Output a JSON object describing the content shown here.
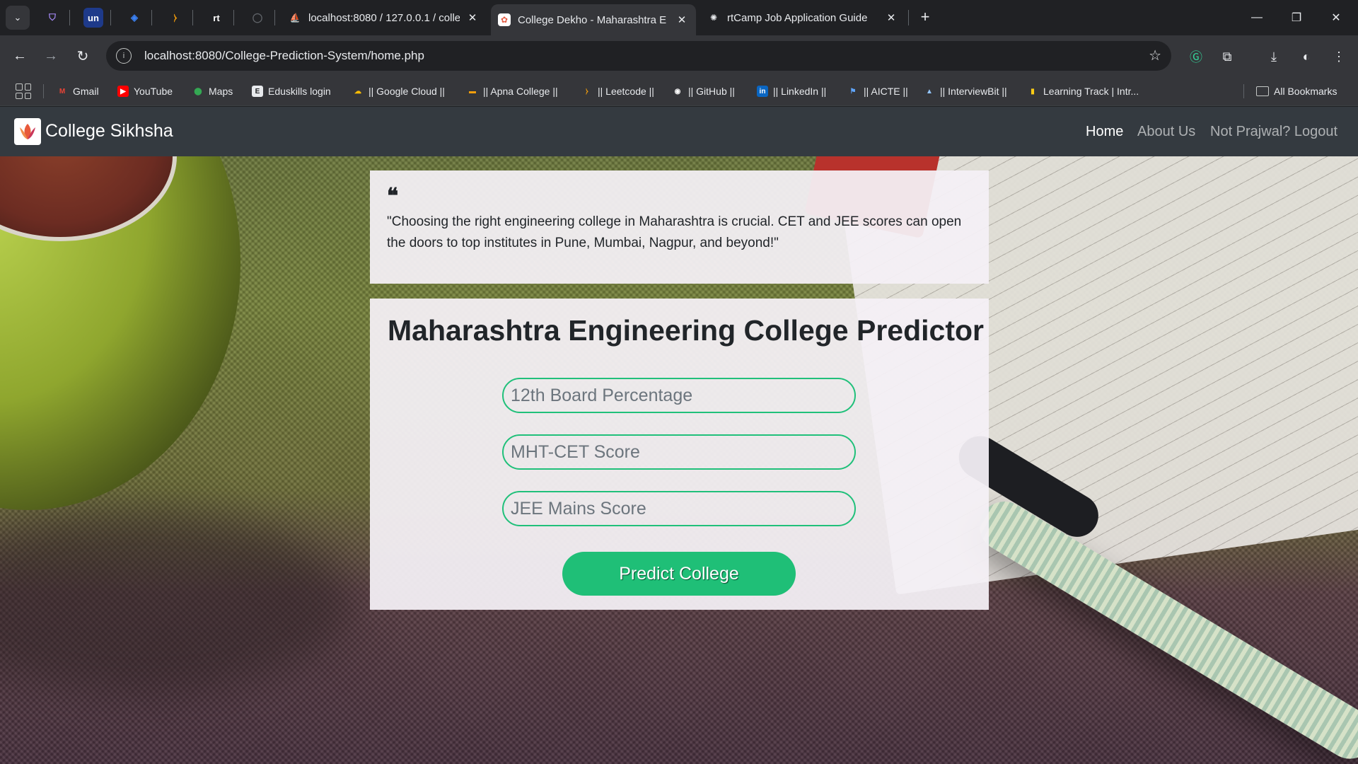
{
  "browser": {
    "tabs": [
      {
        "title": "localhost:8080 / 127.0.0.1 / colle",
        "close": "✕"
      },
      {
        "title": "College Dekho - Maharashtra E",
        "close": "✕",
        "active": true
      },
      {
        "title": "rtCamp Job Application Guide",
        "close": "✕"
      }
    ],
    "new_tab": "+",
    "window_controls": {
      "minimize": "—",
      "restore": "❐",
      "close": "✕"
    },
    "address": "localhost:8080/College-Prediction-System/home.php",
    "bookmarks": [
      {
        "label": "Gmail",
        "icon": "gmail-icon"
      },
      {
        "label": "YouTube",
        "icon": "youtube-icon"
      },
      {
        "label": "Maps",
        "icon": "maps-icon"
      },
      {
        "label": "Eduskills login",
        "icon": "eduskills-icon"
      },
      {
        "label": "|| Google Cloud ||",
        "icon": "google-cloud-icon"
      },
      {
        "label": "|| Apna College ||",
        "icon": "apna-college-icon"
      },
      {
        "label": "|| Leetcode ||",
        "icon": "leetcode-icon"
      },
      {
        "label": "|| GitHub ||",
        "icon": "github-icon"
      },
      {
        "label": "|| LinkedIn ||",
        "icon": "linkedin-icon"
      },
      {
        "label": "|| AICTE ||",
        "icon": "aicte-icon"
      },
      {
        "label": "|| InterviewBit ||",
        "icon": "interviewbit-icon"
      },
      {
        "label": "Learning Track | Intr...",
        "icon": "learning-track-icon"
      }
    ],
    "all_bookmarks": "All Bookmarks"
  },
  "navbar": {
    "brand": "College Sikhsha",
    "links": [
      {
        "label": "Home",
        "active": true
      },
      {
        "label": "About Us",
        "active": false
      },
      {
        "label": "Not Prajwal? Logout",
        "active": false
      }
    ]
  },
  "quote": {
    "text": "\"Choosing the right engineering college in Maharashtra is crucial. CET and JEE scores can open the doors to top institutes in Pune, Mumbai, Nagpur, and beyond!\""
  },
  "form": {
    "title": "Maharashtra Engineering College Predictor",
    "fields": [
      {
        "placeholder": "12th Board Percentage"
      },
      {
        "placeholder": "MHT-CET Score"
      },
      {
        "placeholder": "JEE Mains Score"
      }
    ],
    "submit_label": "Predict College"
  },
  "colors": {
    "navbar": "#343a40",
    "accent": "#1fbf77",
    "browser_frame": "#202124",
    "toolbar": "#35363a"
  }
}
